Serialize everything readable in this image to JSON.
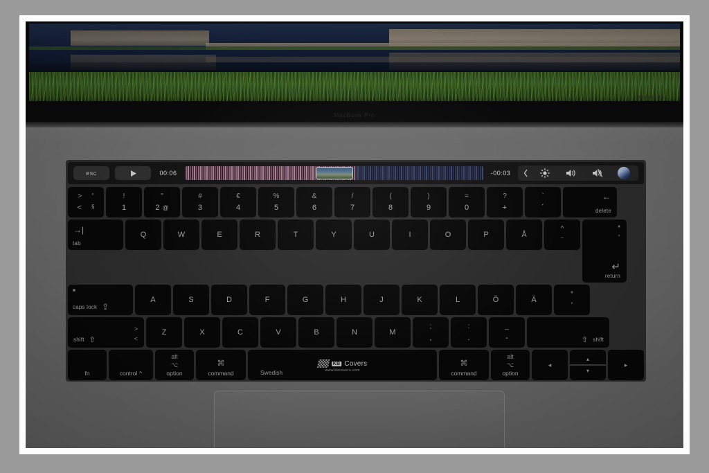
{
  "photo": {
    "device_label": "MacBook Pro",
    "screen_caption": "MacBook Pro",
    "frame_color": "#fdfdfd",
    "background_color": "#9a9a9a",
    "wallpaper_description": "fortress building reflected in dark water with green grass foreground"
  },
  "touchbar": {
    "esc_label": "esc",
    "play_icon": "play-icon",
    "elapsed_time": "00:06",
    "remaining_time": "-00:03",
    "waveform_label": "audio-waveform-scrubber",
    "control_strip": [
      {
        "name": "expand-control-strip-icon",
        "glyph": "❮"
      },
      {
        "name": "brightness-icon",
        "glyph": "☀"
      },
      {
        "name": "volume-up-icon",
        "glyph": "🔊"
      },
      {
        "name": "mute-icon",
        "glyph": "🔇"
      },
      {
        "name": "siri-icon",
        "glyph": ""
      }
    ]
  },
  "keyboard": {
    "layout_name": "Swedish",
    "brand": {
      "name": "KB",
      "word": "Covers",
      "url": "www.kbcovers.com"
    },
    "row_numbers": [
      {
        "name": "key-section",
        "top": ">",
        "bottom": "<",
        "top2": "°",
        "bottom2": "§"
      },
      {
        "name": "key-1",
        "top": "!",
        "bottom": "1"
      },
      {
        "name": "key-2",
        "top": "\"",
        "bottom": "2",
        "alt": "@"
      },
      {
        "name": "key-3",
        "top": "#",
        "bottom": "3"
      },
      {
        "name": "key-4",
        "top": "€",
        "bottom": "4"
      },
      {
        "name": "key-5",
        "top": "%",
        "bottom": "5"
      },
      {
        "name": "key-6",
        "top": "&",
        "bottom": "6"
      },
      {
        "name": "key-7",
        "top": "/",
        "bottom": "7"
      },
      {
        "name": "key-8",
        "top": "(",
        "bottom": "8"
      },
      {
        "name": "key-9",
        "top": ")",
        "bottom": "9"
      },
      {
        "name": "key-0",
        "top": "=",
        "bottom": "0"
      },
      {
        "name": "key-plus",
        "top": "?",
        "bottom": "+"
      },
      {
        "name": "key-acute",
        "top": "`",
        "bottom": "´"
      }
    ],
    "delete_key": {
      "glyph": "←",
      "label": "delete"
    },
    "tab_key": {
      "glyph": "→|",
      "label": "tab"
    },
    "row_qwerty": [
      "Q",
      "W",
      "E",
      "R",
      "T",
      "Y",
      "U",
      "I",
      "O",
      "P",
      "Å"
    ],
    "diaeresis_key": {
      "top": "^",
      "bottom": "¨"
    },
    "return_key": {
      "top": "*",
      "bottom": "'",
      "glyph": "↵",
      "label": "return"
    },
    "caps_key": {
      "label": "caps lock",
      "glyph": "⇪"
    },
    "row_home": [
      "A",
      "S",
      "D",
      "F",
      "G",
      "H",
      "J",
      "K",
      "L",
      "Ö",
      "Ä"
    ],
    "shift_left": {
      "label": "shift",
      "glyph": "⇧"
    },
    "angle_key": {
      "top": ">",
      "bottom": "<"
    },
    "row_bottom": [
      "Z",
      "X",
      "C",
      "V",
      "B",
      "N",
      "M"
    ],
    "punct_keys": [
      {
        "name": "key-semicolon",
        "top": ";",
        "bottom": ","
      },
      {
        "name": "key-colon",
        "top": ":",
        "bottom": "."
      },
      {
        "name": "key-underscore",
        "top": "_",
        "bottom": "-"
      }
    ],
    "shift_right": {
      "label": "shift",
      "glyph": "⇧"
    },
    "modifiers": {
      "fn": {
        "label": "fn"
      },
      "control": {
        "label": "control",
        "glyph": "^"
      },
      "option_left": {
        "top": "alt",
        "glyph": "⌥",
        "label": "option"
      },
      "command_left": {
        "glyph": "⌘",
        "label": "command"
      },
      "space": {
        "label": "Swedish"
      },
      "command_right": {
        "glyph": "⌘",
        "label": "command"
      },
      "option_right": {
        "top": "alt",
        "glyph": "⌥",
        "label": "option"
      }
    },
    "arrows": {
      "left": "◂",
      "up": "▴",
      "down": "▾",
      "right": "▸"
    }
  }
}
